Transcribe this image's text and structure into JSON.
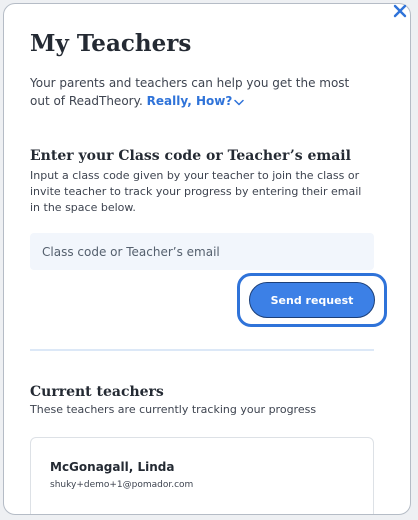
{
  "dialog": {
    "title": "My Teachers",
    "close_icon": "close-icon",
    "intro_text": "Your parents and teachers can help you get the most out of ReadTheory.",
    "how_link": "Really, How?",
    "how_icon": "chevron-down-icon"
  },
  "request": {
    "heading": "Enter your Class code or Teacher’s email",
    "description": "Input a class code given by your teacher to join the class or invite teacher to track your progress by entering their email in the space below.",
    "input_value": "",
    "input_placeholder": "Class code or Teacher’s email",
    "send_label": "Send request"
  },
  "current_teachers": {
    "heading": "Current teachers",
    "subtitle": "These teachers are currently tracking your progress",
    "list": [
      {
        "name": "McGonagall, Linda",
        "email": "shuky+demo+1@pomador.com"
      }
    ]
  },
  "colors": {
    "accent": "#2f73d9",
    "button": "#3c80e6",
    "text": "#242a33",
    "input_background": "#f2f6fc"
  }
}
